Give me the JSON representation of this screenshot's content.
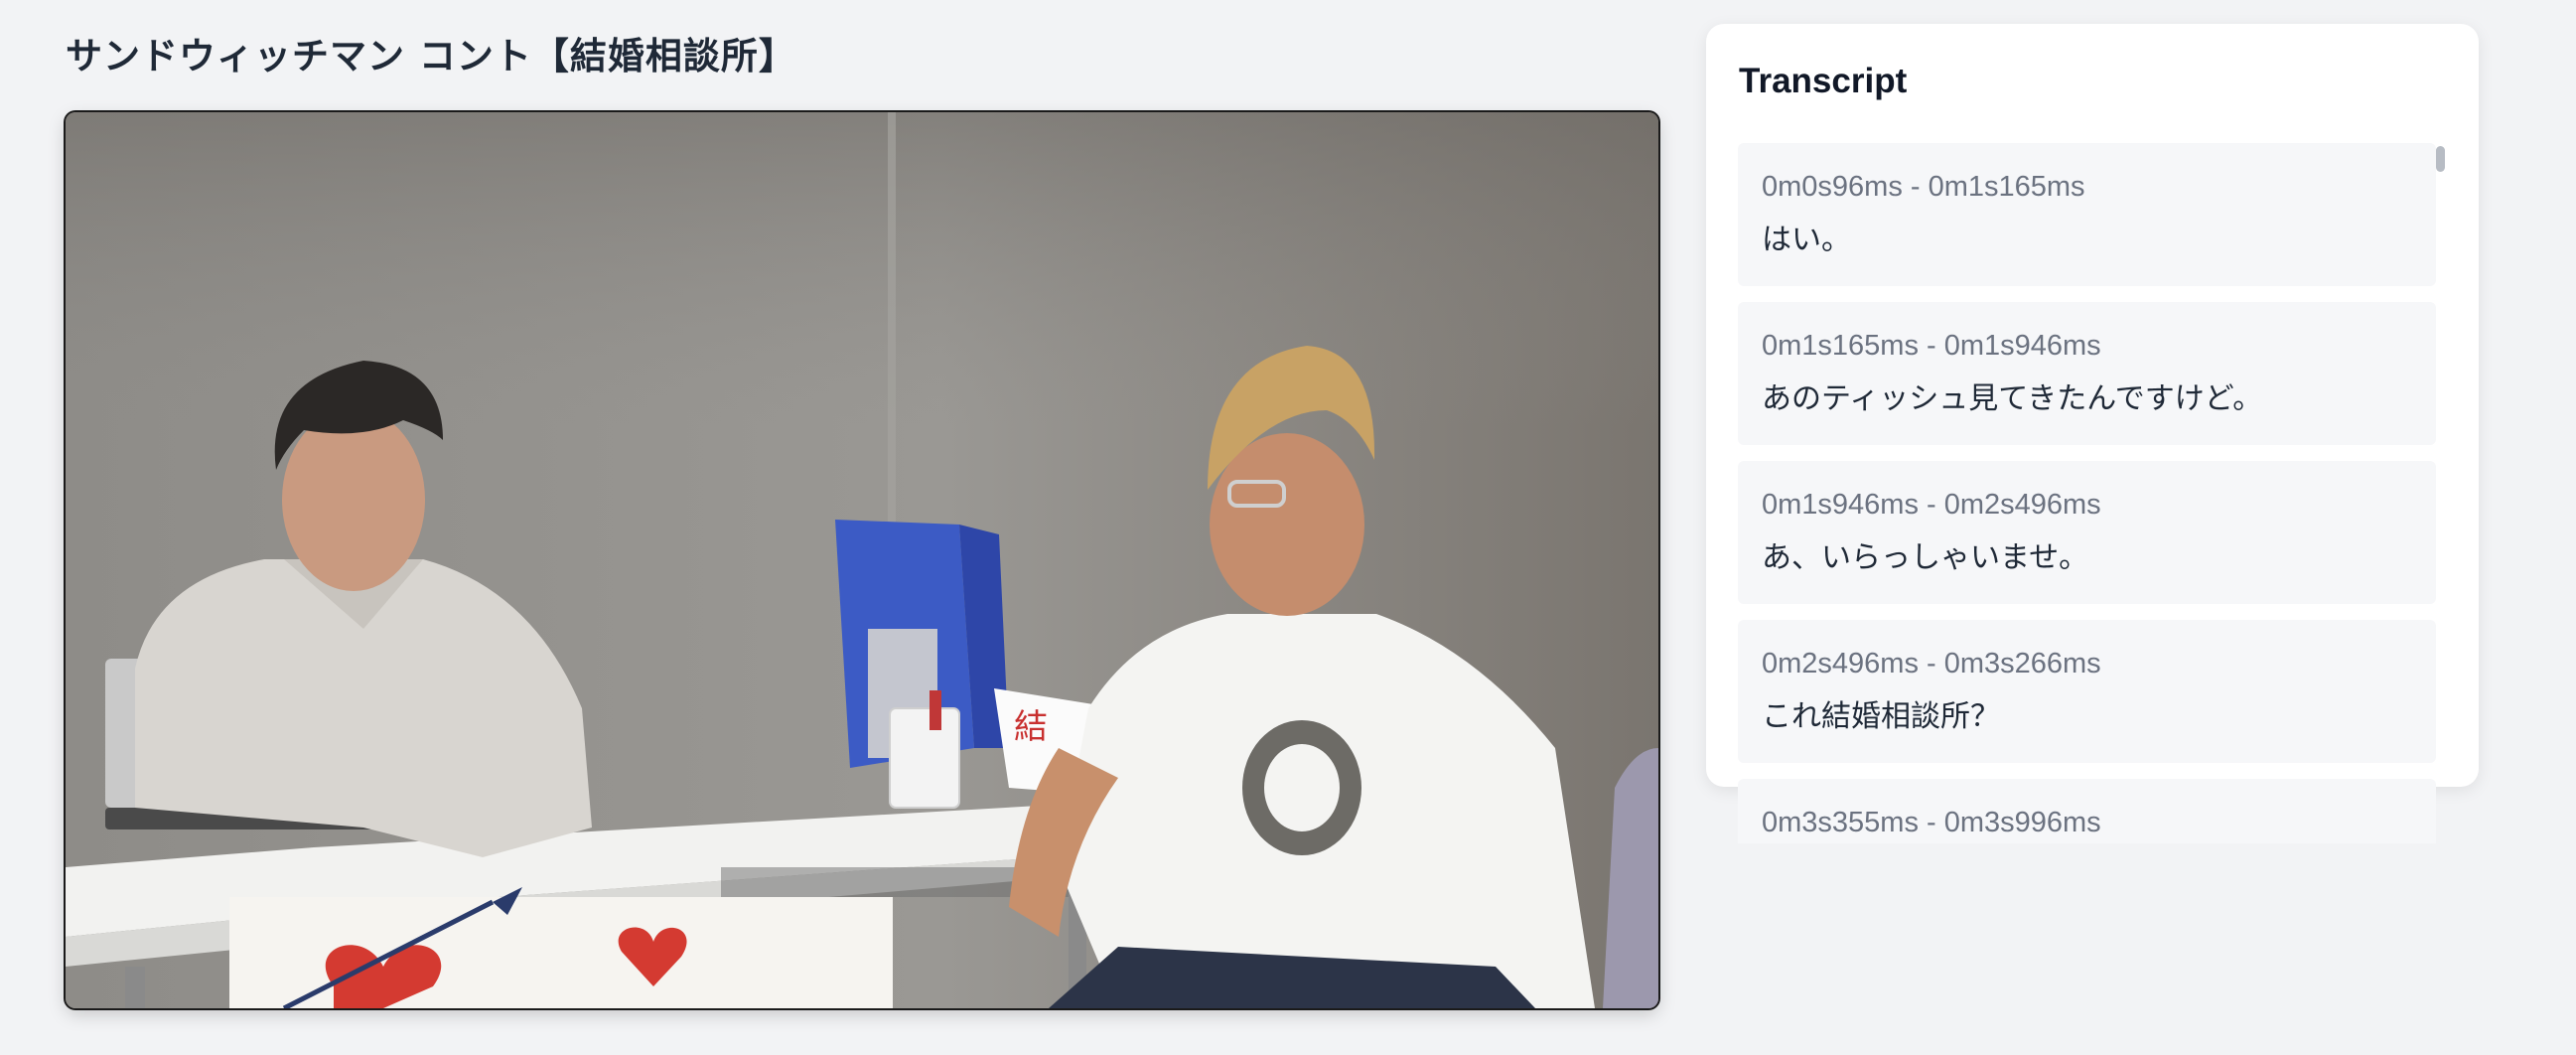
{
  "page": {
    "title": "サンドウィッチマン コント【結婚相談所】"
  },
  "video": {
    "description_icon": "video-player"
  },
  "transcript": {
    "title": "Transcript",
    "segments": [
      {
        "time": "0m0s96ms - 0m1s165ms",
        "text": "はい。"
      },
      {
        "time": "0m1s165ms - 0m1s946ms",
        "text": "あのティッシュ見てきたんですけど。"
      },
      {
        "time": "0m1s946ms - 0m2s496ms",
        "text": "あ、いらっしゃいませ。"
      },
      {
        "time": "0m2s496ms - 0m3s266ms",
        "text": "これ結婚相談所？"
      },
      {
        "time": "0m3s355ms - 0m3s996ms",
        "text": ""
      }
    ]
  },
  "colors": {
    "background": "#f2f3f5",
    "card": "#ffffff",
    "segment_bg": "#f6f7f9",
    "time_text": "#6b7280",
    "body_text": "#1f2937"
  }
}
